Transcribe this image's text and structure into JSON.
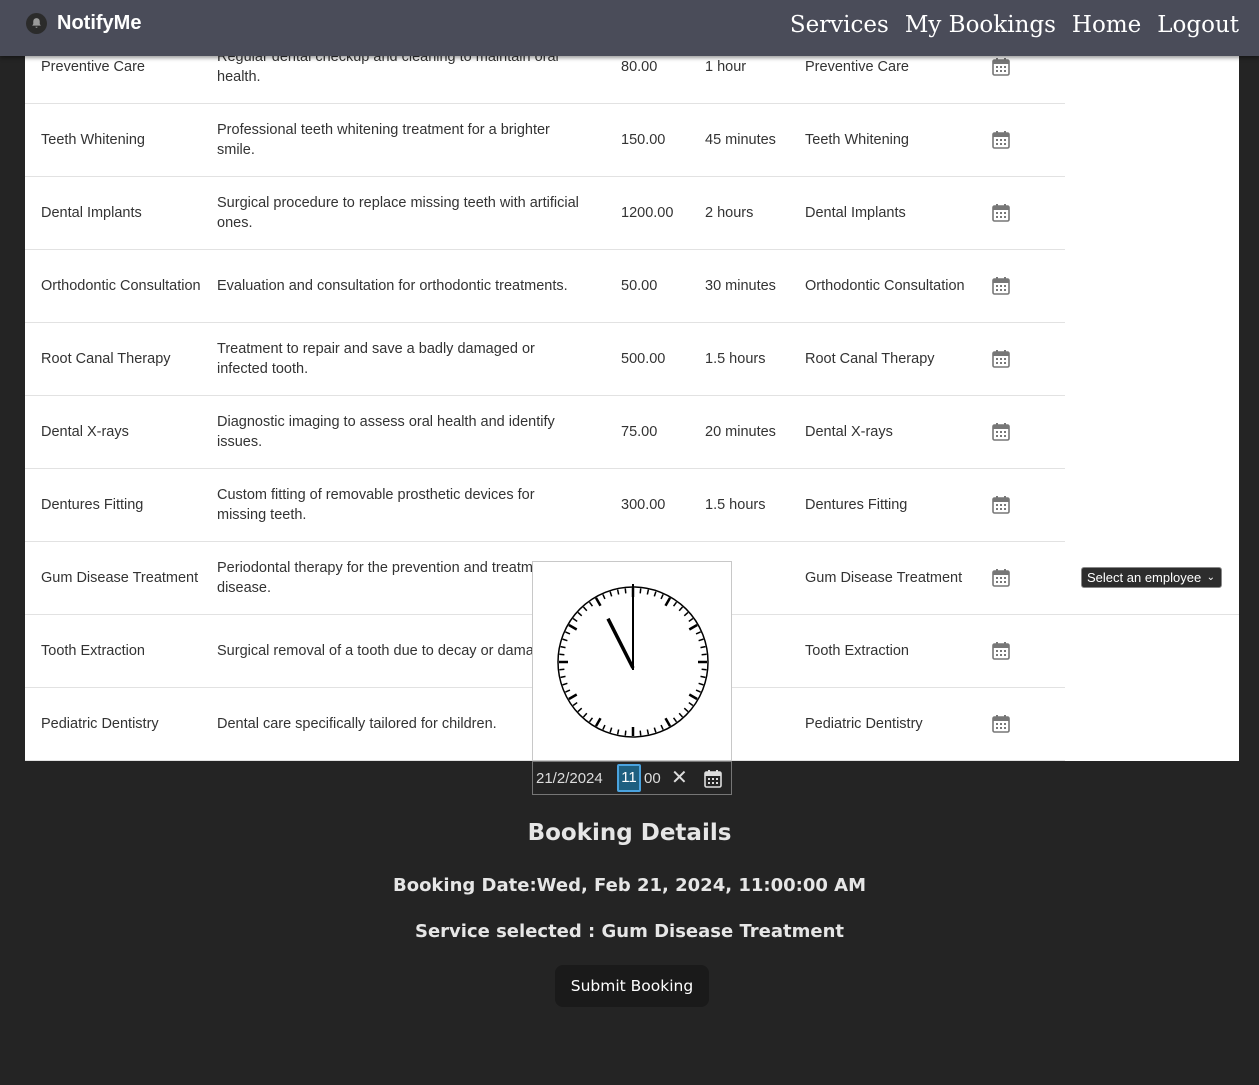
{
  "app": {
    "name": "NotifyMe",
    "logo_icon": "bell-icon"
  },
  "nav": [
    {
      "label": "Services"
    },
    {
      "label": "My Bookings"
    },
    {
      "label": "Home"
    },
    {
      "label": "Logout"
    }
  ],
  "services": [
    {
      "name": "Preventive Care",
      "description": "Regular dental checkup and cleaning to maintain oral health.",
      "price": "80.00",
      "duration": "1 hour",
      "category": "Preventive Care"
    },
    {
      "name": "Teeth Whitening",
      "description": "Professional teeth whitening treatment for a brighter smile.",
      "price": "150.00",
      "duration": "45 minutes",
      "category": "Teeth Whitening"
    },
    {
      "name": "Dental Implants",
      "description": "Surgical procedure to replace missing teeth with artificial ones.",
      "price": "1200.00",
      "duration": "2 hours",
      "category": "Dental Implants"
    },
    {
      "name": "Orthodontic Consultation",
      "description": "Evaluation and consultation for orthodontic treatments.",
      "price": "50.00",
      "duration": "30 minutes",
      "category": "Orthodontic Consultation"
    },
    {
      "name": "Root Canal Therapy",
      "description": "Treatment to repair and save a badly damaged or infected tooth.",
      "price": "500.00",
      "duration": "1.5 hours",
      "category": "Root Canal Therapy"
    },
    {
      "name": "Dental X-rays",
      "description": "Diagnostic imaging to assess oral health and identify issues.",
      "price": "75.00",
      "duration": "20 minutes",
      "category": "Dental X-rays"
    },
    {
      "name": "Dentures Fitting",
      "description": "Custom fitting of removable prosthetic devices for missing teeth.",
      "price": "300.00",
      "duration": "1.5 hours",
      "category": "Dentures Fitting"
    },
    {
      "name": "Gum Disease Treatment",
      "description": "Periodontal therapy for the prevention and treatm gum disease.",
      "price": "",
      "duration": "our",
      "category": "Gum Disease Treatment"
    },
    {
      "name": "Tooth Extraction",
      "description": "Surgical removal of a tooth due to decay or dama",
      "price": "",
      "duration": "utes",
      "category": "Tooth Extraction"
    },
    {
      "name": "Pediatric Dentistry",
      "description": "Dental care specifically tailored for children.",
      "price": "",
      "duration": "our",
      "category": "Pediatric Dentistry"
    }
  ],
  "employee_select": {
    "selected": "Select an employee"
  },
  "datetime_input": {
    "date": "21/2/2024",
    "hour": "11",
    "minute": "00",
    "clear": "✕"
  },
  "clock": {
    "hour": 11,
    "minute": 0
  },
  "booking": {
    "title": "Booking Details",
    "date_line": "Booking Date:Wed, Feb 21, 2024, 11:00:00 AM",
    "service_line": "Service selected : Gum Disease Treatment",
    "submit_label": "Submit Booking"
  }
}
